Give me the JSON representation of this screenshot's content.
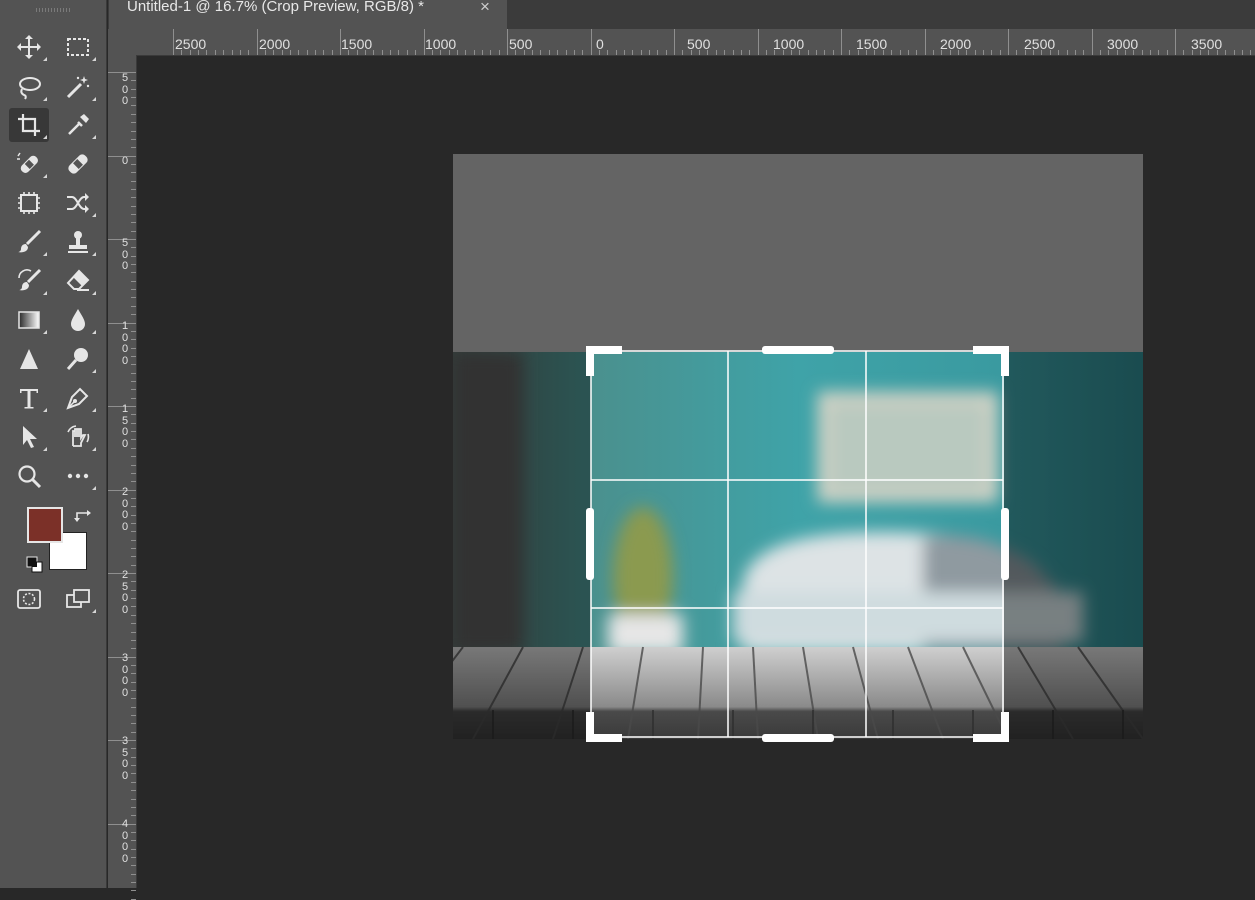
{
  "document": {
    "tab_title": "Untitled-1 @ 16.7% (Crop Preview, RGB/8) *",
    "close_glyph": "×"
  },
  "rulers": {
    "horizontal": [
      "2500",
      "2000",
      "1500",
      "1000",
      "500",
      "0",
      "500",
      "1000",
      "1500",
      "2000",
      "2500",
      "3000",
      "3500"
    ],
    "vertical": [
      "500",
      "0",
      "500",
      "1000",
      "1500",
      "2000",
      "2500",
      "3000",
      "3500",
      "4000"
    ]
  },
  "colors": {
    "foreground": "#7b3028",
    "background": "#ffffff",
    "crop_handles": "#ffffff",
    "wall": "#3fa3a8"
  },
  "tools": [
    {
      "name": "move-tool",
      "icon": "move-icon",
      "active": false
    },
    {
      "name": "rectangular-marquee-tool",
      "icon": "rectangular-marquee-icon",
      "active": false
    },
    {
      "name": "lasso-tool",
      "icon": "lasso-icon",
      "active": false
    },
    {
      "name": "magic-wand-tool",
      "icon": "magic-wand-icon",
      "active": false
    },
    {
      "name": "crop-tool",
      "icon": "crop-icon",
      "active": true
    },
    {
      "name": "eyedropper-tool",
      "icon": "eyedropper-icon",
      "active": false
    },
    {
      "name": "spot-healing-brush-tool",
      "icon": "spot-healing-icon",
      "active": false
    },
    {
      "name": "healing-brush-tool",
      "icon": "bandage-icon",
      "active": false
    },
    {
      "name": "frame-tool",
      "icon": "frame-icon",
      "active": false
    },
    {
      "name": "content-aware-move-tool",
      "icon": "shuffle-icon",
      "active": false
    },
    {
      "name": "brush-tool",
      "icon": "brush-icon",
      "active": false
    },
    {
      "name": "clone-stamp-tool",
      "icon": "stamp-icon",
      "active": false
    },
    {
      "name": "history-brush-tool",
      "icon": "history-brush-icon",
      "active": false
    },
    {
      "name": "eraser-tool",
      "icon": "eraser-icon",
      "active": false
    },
    {
      "name": "gradient-tool",
      "icon": "gradient-icon",
      "active": false
    },
    {
      "name": "blur-tool",
      "icon": "drop-icon",
      "active": false
    },
    {
      "name": "sharpen-tool",
      "icon": "triangle-icon",
      "active": false
    },
    {
      "name": "dodge-tool",
      "icon": "dodge-icon",
      "active": false
    },
    {
      "name": "type-tool",
      "icon": "type-icon",
      "active": false
    },
    {
      "name": "pen-tool",
      "icon": "pen-icon",
      "active": false
    },
    {
      "name": "path-selection-tool",
      "icon": "arrow-icon",
      "active": false
    },
    {
      "name": "rotate-view-tool",
      "icon": "hand-rotate-icon",
      "active": false
    },
    {
      "name": "zoom-tool",
      "icon": "zoom-icon",
      "active": false
    },
    {
      "name": "edit-toolbar",
      "icon": "more-icon",
      "active": false
    },
    {
      "name": "quick-mask-mode",
      "icon": "quick-mask-icon",
      "active": false
    },
    {
      "name": "screen-mode",
      "icon": "screen-mode-icon",
      "active": false
    }
  ]
}
